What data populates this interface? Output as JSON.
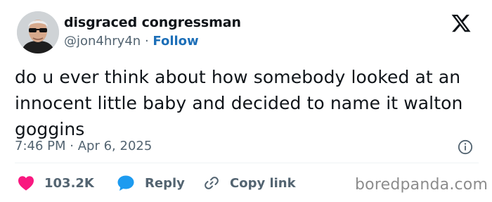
{
  "author": {
    "display_name": "disgraced congressman",
    "handle": "@jon4hry4n",
    "separator": "·",
    "follow_label": "Follow"
  },
  "tweet": {
    "text": "do u ever think about how somebody looked at an innocent little baby and decided to name it walton goggins",
    "time": "7:46 PM",
    "date_separator": "·",
    "date": "Apr 6, 2025"
  },
  "actions": {
    "likes_count": "103.2K",
    "reply_label": "Reply",
    "copy_link_label": "Copy link"
  },
  "watermark": "boredpanda.com",
  "icons": {
    "brand": "x-logo-icon",
    "info": "info-icon",
    "like": "heart-icon",
    "reply": "speech-bubble-icon",
    "copy": "link-icon"
  },
  "colors": {
    "heart": "#f91880",
    "reply_bubble": "#1d9bf0",
    "follow": "#1d6fb8",
    "muted": "#536471"
  }
}
